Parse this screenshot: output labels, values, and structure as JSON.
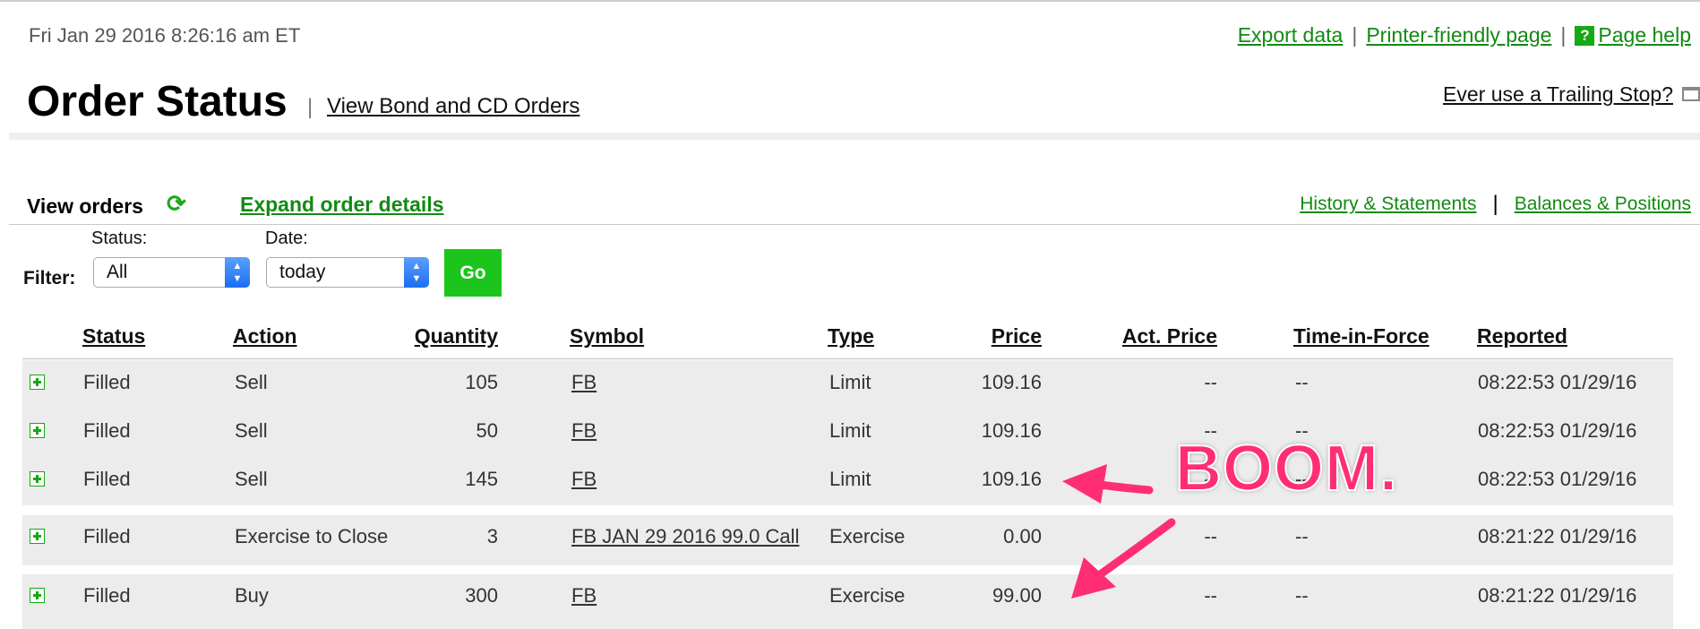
{
  "header": {
    "timestamp": "Fri Jan 29 2016 8:26:16 am ET",
    "export_label": "Export data",
    "printer_label": "Printer-friendly page",
    "help_icon": "?",
    "help_label": "Page help",
    "separator": "|"
  },
  "page": {
    "title": "Order Status",
    "title_separator": "|",
    "bond_link": "View Bond and CD Orders",
    "trailing_link": "Ever use a Trailing Stop?"
  },
  "toolbar": {
    "view_orders": "View orders",
    "refresh_icon": "refresh-icon",
    "expand_label": "Expand order details",
    "history_label": "History & Statements",
    "balances_label": "Balances & Positions",
    "separator": "|"
  },
  "filter": {
    "label": "Filter:",
    "status_label": "Status:",
    "status_value": "All",
    "date_label": "Date:",
    "date_value": "today",
    "go_label": "Go"
  },
  "table": {
    "columns": [
      "Status",
      "Action",
      "Quantity",
      "Symbol",
      "Type",
      "Price",
      "Act. Price",
      "Time-in-Force",
      "Reported"
    ],
    "rows": [
      {
        "status": "Filled",
        "action": "Sell",
        "quantity": "105",
        "symbol": "FB",
        "type": "Limit",
        "price": "109.16",
        "act_price": "--",
        "tif": "--",
        "reported": "08:22:53 01/29/16"
      },
      {
        "status": "Filled",
        "action": "Sell",
        "quantity": "50",
        "symbol": "FB",
        "type": "Limit",
        "price": "109.16",
        "act_price": "--",
        "tif": "--",
        "reported": "08:22:53 01/29/16"
      },
      {
        "status": "Filled",
        "action": "Sell",
        "quantity": "145",
        "symbol": "FB",
        "type": "Limit",
        "price": "109.16",
        "act_price": "--",
        "tif": "--",
        "reported": "08:22:53 01/29/16"
      },
      {
        "status": "Filled",
        "action": "Exercise to Close",
        "quantity": "3",
        "symbol": "FB JAN 29 2016 99.0 Call",
        "type": "Exercise",
        "price": "0.00",
        "act_price": "--",
        "tif": "--",
        "reported": "08:21:22 01/29/16"
      },
      {
        "status": "Filled",
        "action": "Buy",
        "quantity": "300",
        "symbol": "FB",
        "type": "Exercise",
        "price": "99.00",
        "act_price": "--",
        "tif": "--",
        "reported": "08:21:22 01/29/16"
      }
    ]
  },
  "annotation": {
    "text": "BOOM.",
    "color": "#ff2e74"
  },
  "colors": {
    "link_green": "#138a13",
    "button_green": "#1cc51c",
    "row_gray": "#ececec"
  }
}
